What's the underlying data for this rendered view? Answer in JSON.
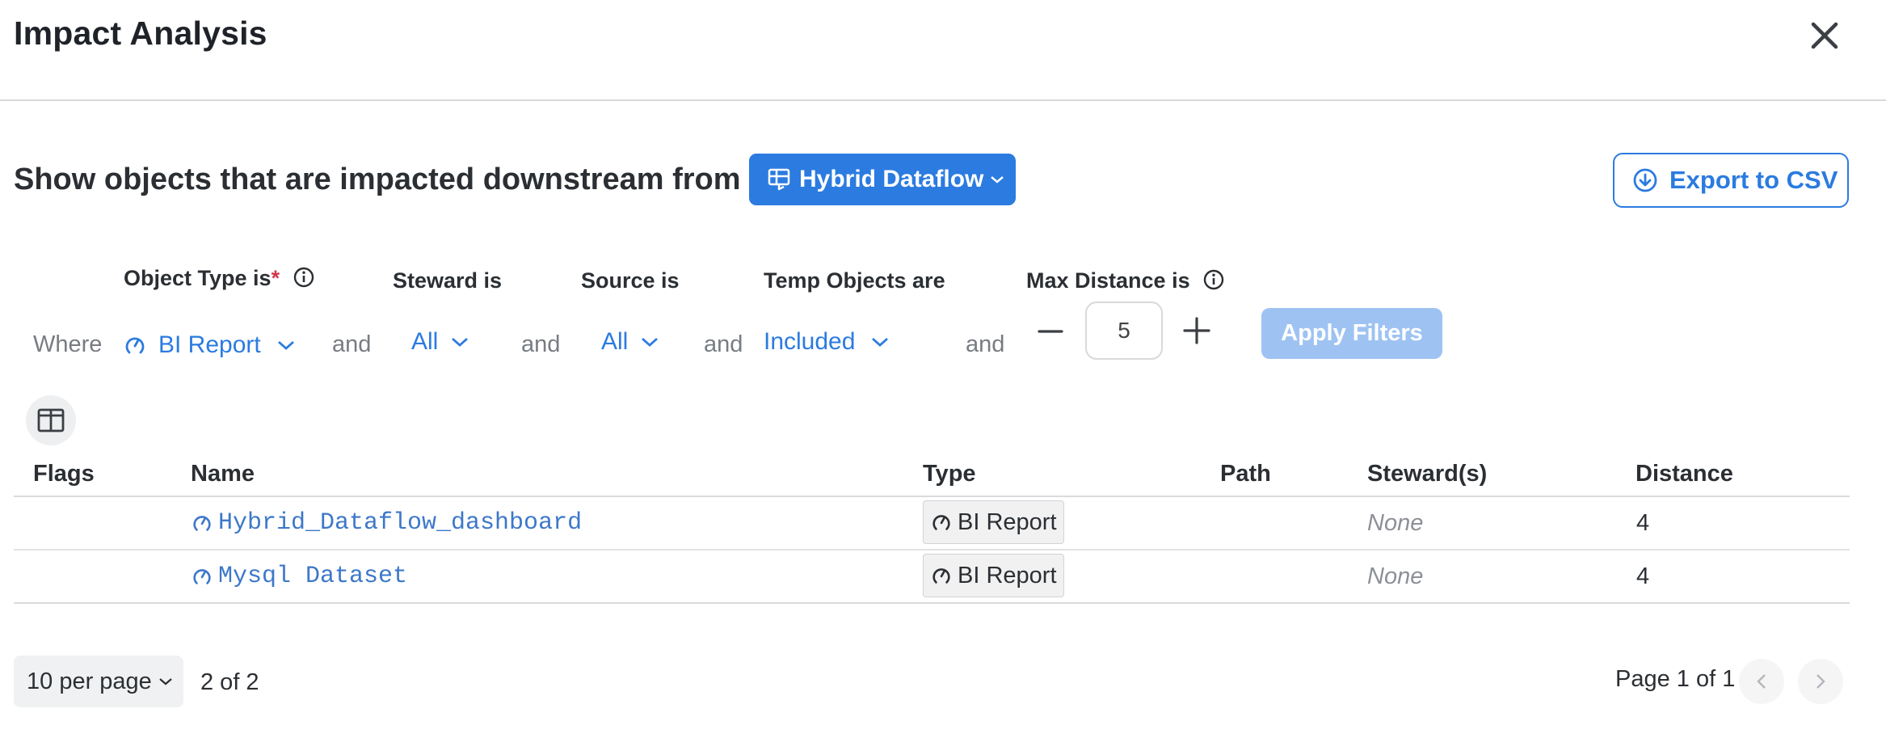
{
  "dialog": {
    "title": "Impact Analysis",
    "close_icon": "close-icon"
  },
  "headline": {
    "text": "Show objects that are impacted downstream from",
    "source_label": "Hybrid Dataflow",
    "source_icon": "dataflow-icon",
    "export_label": "Export to CSV",
    "export_icon": "download-circle-icon"
  },
  "filters": {
    "where": "Where",
    "and": "and",
    "object_type": {
      "header": "Object Type is",
      "required_mark": "*",
      "value": "BI Report",
      "icon": "bi-report-icon"
    },
    "steward": {
      "header": "Steward is",
      "value": "All"
    },
    "source": {
      "header": "Source is",
      "value": "All"
    },
    "temp_objects": {
      "header": "Temp Objects are",
      "value": "Included"
    },
    "max_distance": {
      "header": "Max Distance is",
      "value": "5"
    },
    "apply_label": "Apply Filters"
  },
  "table": {
    "columns": [
      "Flags",
      "Name",
      "Type",
      "Path",
      "Steward(s)",
      "Distance"
    ],
    "rows": [
      {
        "flags": "",
        "name": "Hybrid_Dataflow_dashboard",
        "type": "BI Report",
        "path": "",
        "stewards": "None",
        "distance": "4"
      },
      {
        "flags": "",
        "name": "Mysql Dataset",
        "type": "BI Report",
        "path": "",
        "stewards": "None",
        "distance": "4"
      }
    ]
  },
  "pagination": {
    "per_page": "10 per page",
    "count": "2 of 2",
    "page": "Page 1 of 1"
  },
  "colors": {
    "accent": "#2b7be0",
    "apply_disabled": "#9ec3f2",
    "link": "#3d78c9",
    "required": "#d0364a"
  }
}
